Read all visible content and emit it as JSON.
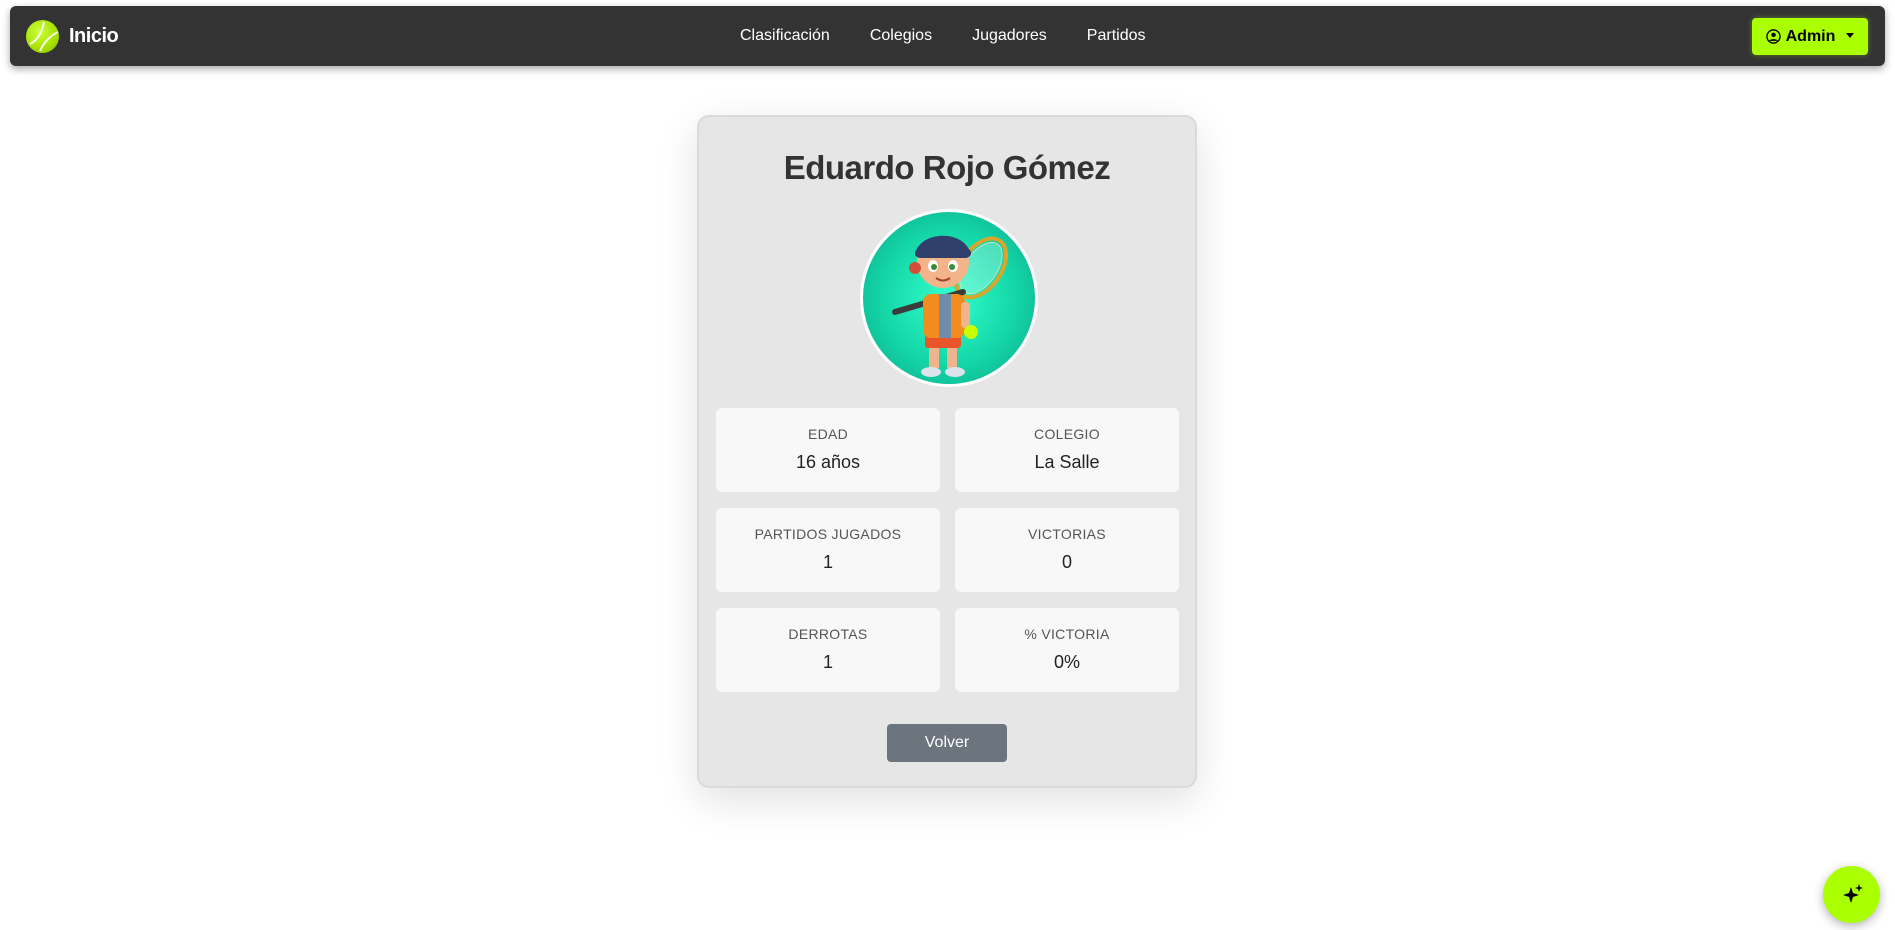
{
  "navbar": {
    "brand_label": "Inicio",
    "brand_icon": "tennis-ball-icon",
    "links": [
      {
        "label": "Clasificación"
      },
      {
        "label": "Colegios"
      },
      {
        "label": "Jugadores"
      },
      {
        "label": "Partidos"
      }
    ],
    "user_menu": {
      "label": "Admin",
      "icon": "user-circle-icon"
    }
  },
  "player": {
    "name": "Eduardo Rojo Gómez",
    "avatar_icon": "player-avatar-image",
    "stats": [
      {
        "label": "EDAD",
        "value": "16 años"
      },
      {
        "label": "COLEGIO",
        "value": "La Salle"
      },
      {
        "label": "PARTIDOS JUGADOS",
        "value": "1"
      },
      {
        "label": "VICTORIAS",
        "value": "0"
      },
      {
        "label": "DERROTAS",
        "value": "1"
      },
      {
        "label": "% VICTORIA",
        "value": "0%"
      }
    ],
    "back_button": "Volver"
  },
  "fab": {
    "icon": "sparkles-icon"
  },
  "colors": {
    "navbar_bg": "#333333",
    "accent": "#aaff00",
    "card_bg": "#e6e6e6",
    "secondary_button": "#6c757d"
  }
}
